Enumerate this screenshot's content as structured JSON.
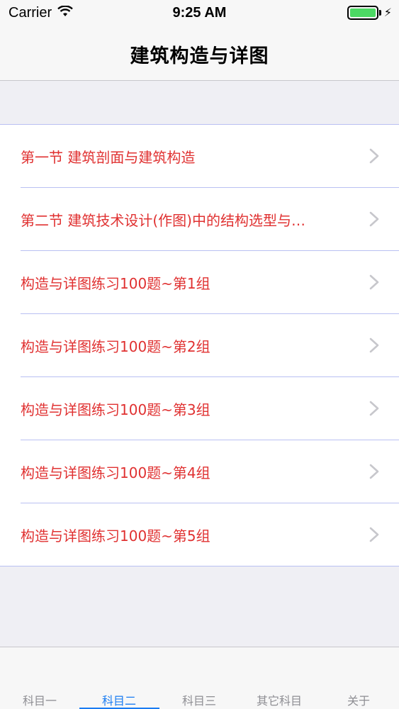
{
  "status_bar": {
    "carrier": "Carrier",
    "time": "9:25 AM"
  },
  "nav": {
    "title": "建筑构造与详图"
  },
  "list": {
    "items": [
      {
        "label": "第一节  建筑剖面与建筑构造"
      },
      {
        "label": "第二节  建筑技术设计(作图)中的结构选型与…"
      },
      {
        "label": "构造与详图练习100题~第1组"
      },
      {
        "label": "构造与详图练习100题~第2组"
      },
      {
        "label": "构造与详图练习100题~第3组"
      },
      {
        "label": "构造与详图练习100题~第4组"
      },
      {
        "label": "构造与详图练习100题~第5组"
      }
    ]
  },
  "tabs": [
    {
      "label": "科目一"
    },
    {
      "label": "科目二",
      "active": true
    },
    {
      "label": "科目三"
    },
    {
      "label": "其它科目"
    },
    {
      "label": "关于"
    }
  ],
  "colors": {
    "item_text": "#e03131",
    "active_tab": "#1a7cf2",
    "battery": "#4cd964"
  },
  "icons": {
    "row_chevron": "chevron-right-icon",
    "wifi": "wifi-icon",
    "battery": "battery-icon"
  }
}
